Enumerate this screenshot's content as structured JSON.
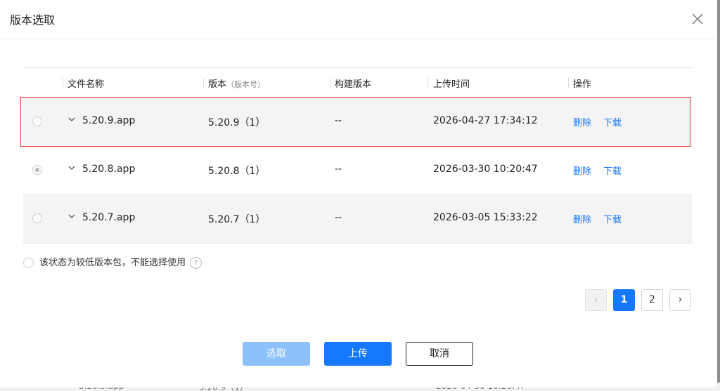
{
  "dialog": {
    "title": "版本选取"
  },
  "table": {
    "headers": {
      "filename": "文件名称",
      "version": "版本",
      "version_sub": "（版本号）",
      "build": "构建版本",
      "upload_time": "上传时间",
      "actions": "操作"
    },
    "rows": [
      {
        "filename": "5.20.9.app",
        "version": "5.20.9（1）",
        "build": "--",
        "upload_time": "2026-04-27 17:34:12",
        "delete": "删除",
        "download": "下载",
        "checked": false
      },
      {
        "filename": "5.20.8.app",
        "version": "5.20.8（1）",
        "build": "--",
        "upload_time": "2026-03-30 10:20:47",
        "delete": "删除",
        "download": "下载",
        "checked": true
      },
      {
        "filename": "5.20.7.app",
        "version": "5.20.7（1）",
        "build": "--",
        "upload_time": "2026-03-05 15:33:22",
        "delete": "删除",
        "download": "下载",
        "checked": false
      }
    ]
  },
  "note": {
    "text": "该状态为较低版本包，不能选择使用",
    "help": "?"
  },
  "pagination": {
    "prev": "‹",
    "pages": [
      "1",
      "2"
    ],
    "current": "1",
    "next": "›"
  },
  "footer": {
    "select_label": "选取",
    "upload_label": "上传",
    "cancel_label": "取消"
  },
  "colors": {
    "primary": "#1677ff",
    "primary_disabled": "#8dc1fb",
    "highlight": "#e8393a"
  }
}
